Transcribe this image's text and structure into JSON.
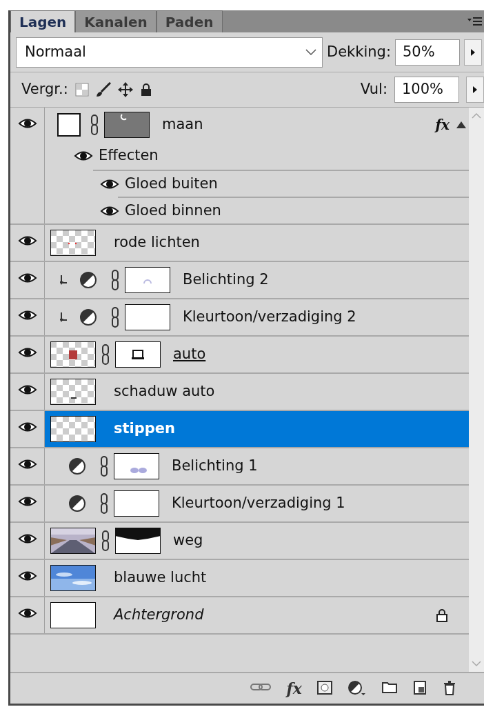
{
  "tabs": [
    {
      "label": "Lagen",
      "selected": true
    },
    {
      "label": "Kanalen",
      "selected": false
    },
    {
      "label": "Paden",
      "selected": false
    }
  ],
  "blend_mode": {
    "value": "Normaal"
  },
  "opacity": {
    "label": "Dekking:",
    "value": "50%"
  },
  "lock": {
    "label": "Vergr.:"
  },
  "fill": {
    "label": "Vul:",
    "value": "100%"
  },
  "layers": [
    {
      "name": "maan",
      "kind": "fill",
      "visible": true,
      "selected": false,
      "clipped": false,
      "linked": true,
      "mask": true,
      "underlined": false,
      "locked": false,
      "fx": "fx",
      "expanded": true,
      "effects": {
        "label": "Effecten",
        "visible": true,
        "items": [
          {
            "name": "Gloed buiten",
            "visible": true
          },
          {
            "name": "Gloed binnen",
            "visible": true
          }
        ]
      }
    },
    {
      "name": "rode lichten",
      "kind": "pixel",
      "visible": true,
      "selected": false,
      "clipped": false,
      "linked": false,
      "mask": false,
      "underlined": false,
      "locked": false
    },
    {
      "name": "Belichting 2",
      "kind": "adjustment",
      "visible": true,
      "selected": false,
      "clipped": true,
      "linked": true,
      "mask": true,
      "underlined": false,
      "locked": false
    },
    {
      "name": "Kleurtoon/verzadiging 2",
      "kind": "adjustment",
      "visible": true,
      "selected": false,
      "clipped": true,
      "linked": true,
      "mask": true,
      "underlined": false,
      "locked": false
    },
    {
      "name": "auto",
      "kind": "pixel",
      "visible": true,
      "selected": false,
      "clipped": false,
      "linked": true,
      "mask": true,
      "underlined": true,
      "locked": false
    },
    {
      "name": "schaduw auto",
      "kind": "pixel",
      "visible": true,
      "selected": false,
      "clipped": false,
      "linked": false,
      "mask": false,
      "underlined": false,
      "locked": false
    },
    {
      "name": "stippen",
      "kind": "pixel",
      "visible": true,
      "selected": true,
      "clipped": false,
      "linked": false,
      "mask": false,
      "underlined": false,
      "locked": false
    },
    {
      "name": "Belichting 1",
      "kind": "adjustment",
      "visible": true,
      "selected": false,
      "clipped": false,
      "linked": true,
      "mask": true,
      "underlined": false,
      "locked": false
    },
    {
      "name": "Kleurtoon/verzadiging 1",
      "kind": "adjustment",
      "visible": true,
      "selected": false,
      "clipped": false,
      "linked": true,
      "mask": true,
      "underlined": false,
      "locked": false
    },
    {
      "name": "weg",
      "kind": "pixel",
      "visible": true,
      "selected": false,
      "clipped": false,
      "linked": true,
      "mask": true,
      "underlined": false,
      "locked": false
    },
    {
      "name": "blauwe lucht",
      "kind": "pixel",
      "visible": true,
      "selected": false,
      "clipped": false,
      "linked": false,
      "mask": false,
      "underlined": false,
      "locked": false
    },
    {
      "name": "Achtergrond",
      "kind": "background",
      "visible": true,
      "selected": false,
      "clipped": false,
      "linked": false,
      "mask": false,
      "underlined": false,
      "locked": true
    }
  ],
  "footer_buttons": [
    {
      "kind": "link"
    },
    {
      "kind": "fx",
      "label": "fx"
    },
    {
      "kind": "mask"
    },
    {
      "kind": "adjustment"
    },
    {
      "kind": "group"
    },
    {
      "kind": "new"
    },
    {
      "kind": "trash"
    }
  ]
}
